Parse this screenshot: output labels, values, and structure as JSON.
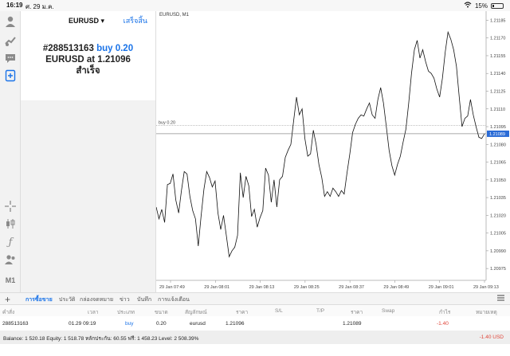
{
  "status": {
    "time": "16:19",
    "date": "ศ. 29 ม.ค.",
    "battery": "15%"
  },
  "order": {
    "symbol": "EURUSD ▾",
    "done_label": "เสร็จสิ้น",
    "ticket": "#288513163",
    "action": "buy 0.20",
    "symbol_line": "EURUSD at",
    "price": "1.21096",
    "result": "สำเร็จ"
  },
  "toolbar": {
    "timeframe": "M1"
  },
  "chart_data": {
    "type": "line",
    "title": "EURUSD, M1",
    "ylim": [
      1.20965,
      1.2119
    ],
    "y_ticks": [
      "1.21185",
      "1.21170",
      "1.21155",
      "1.21140",
      "1.21125",
      "1.21110",
      "1.21095",
      "1.21080",
      "1.21065",
      "1.21050",
      "1.21035",
      "1.21020",
      "1.21005",
      "1.20990",
      "1.20975"
    ],
    "x_ticks": [
      "29 Jan 07:49",
      "29 Jan 08:01",
      "29 Jan 08:13",
      "29 Jan 08:25",
      "29 Jan 08:37",
      "29 Jan 08:49",
      "29 Jan 09:01",
      "29 Jan 09:13"
    ],
    "series": [
      {
        "values": [
          1.21027,
          1.21017,
          1.21025,
          1.21014,
          1.21046,
          1.21047,
          1.21055,
          1.21033,
          1.21022,
          1.21041,
          1.21057,
          1.21055,
          1.21036,
          1.21024,
          1.21017,
          1.20994,
          1.21019,
          1.21042,
          1.21057,
          1.21052,
          1.21044,
          1.21049,
          1.21022,
          1.21008,
          1.2102,
          1.21003,
          1.20985,
          1.2099,
          1.20993,
          1.21003,
          1.21056,
          1.21035,
          1.21053,
          1.21045,
          1.21019,
          1.21025,
          1.2101,
          1.21018,
          1.21024,
          1.2106,
          1.21054,
          1.21031,
          1.2105,
          1.21027,
          1.2105,
          1.21053,
          1.21069,
          1.21075,
          1.2108,
          1.211,
          1.2112,
          1.21105,
          1.2111,
          1.21085,
          1.2107,
          1.21072,
          1.21092,
          1.2108,
          1.21063,
          1.21052,
          1.21036,
          1.2104,
          1.21036,
          1.21043,
          1.2104,
          1.21036,
          1.21041,
          1.21038,
          1.21056,
          1.21072,
          1.2109,
          1.21097,
          1.21102,
          1.21105,
          1.21104,
          1.2111,
          1.21115,
          1.21105,
          1.21102,
          1.21118,
          1.21128,
          1.21115,
          1.21095,
          1.21075,
          1.21062,
          1.21054,
          1.21063,
          1.2107,
          1.21082,
          1.21093,
          1.21115,
          1.2114,
          1.2116,
          1.21168,
          1.21153,
          1.2116,
          1.2115,
          1.21142,
          1.2114,
          1.21136,
          1.21127,
          1.2112,
          1.21136,
          1.21158,
          1.21175,
          1.21169,
          1.2116,
          1.21146,
          1.2112,
          1.21095,
          1.21102,
          1.21104,
          1.21118,
          1.21105,
          1.21095,
          1.21086,
          1.21085,
          1.21089
        ]
      }
    ],
    "price_line": {
      "label": "buy 0.20",
      "value": 1.21096
    },
    "current_price": "1.21089",
    "grid": false
  },
  "tabs": [
    {
      "label": "การซื้อขาย"
    },
    {
      "label": "ประวัติ"
    },
    {
      "label": "กล่องจดหมาย"
    },
    {
      "label": "ข่าว"
    },
    {
      "label": "บันทึก"
    },
    {
      "label": "การแจ้งเตือน"
    }
  ],
  "table": {
    "headers": [
      "คำสั่ง",
      "เวลา",
      "ประเภท",
      "ขนาด",
      "สัญลักษณ์",
      "ราคา",
      "S/L",
      "T/P",
      "ราคา",
      "Swap",
      "กำไร",
      "หมายเหตุ"
    ],
    "row": {
      "order": "288513163",
      "time": "01.29 09:19",
      "type": "buy",
      "size": "0.20",
      "symbol": "eurusd",
      "price": "1.21096",
      "sl": "",
      "tp": "",
      "current": "1.21089",
      "swap": "",
      "profit": "-1.40",
      "comment": ""
    }
  },
  "balance": {
    "text": "Balance: 1 520.18 Equity: 1 518.78 หลักประกัน: 60.55 ฟรี: 1 458.23 Level: 2 508.39%",
    "profit": "-1.40  USD"
  }
}
